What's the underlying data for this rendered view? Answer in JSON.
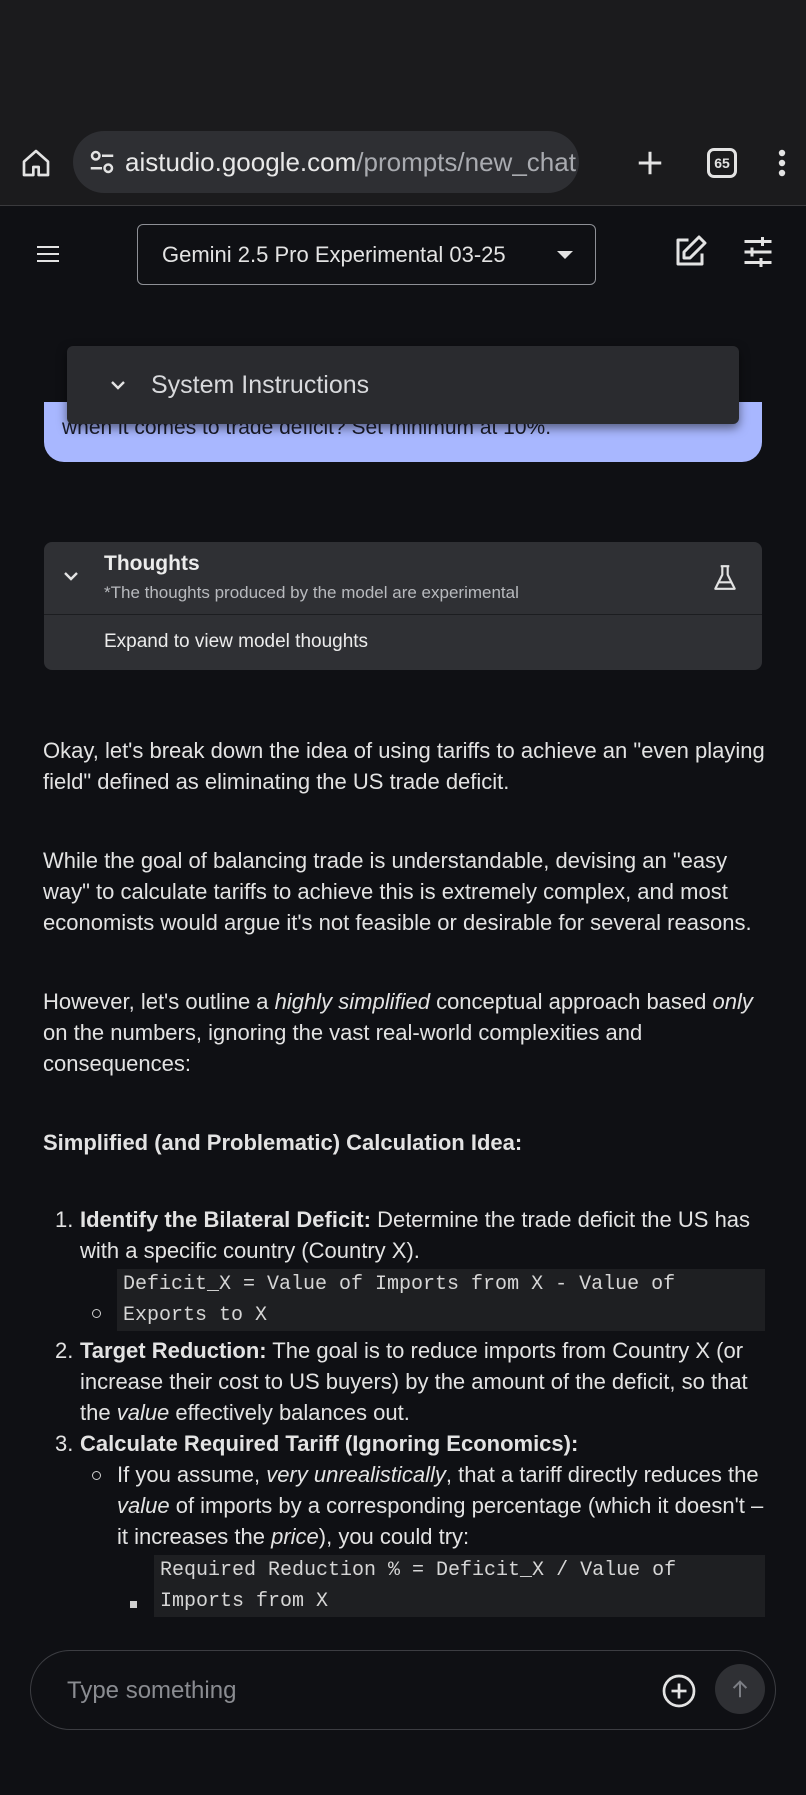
{
  "browser": {
    "url_host": "aistudio.google.com",
    "url_path": "/prompts/new_chat",
    "tab_count": "65"
  },
  "header": {
    "model_label": "Gemini 2.5 Pro Experimental 03-25"
  },
  "system_instructions": {
    "label": "System Instructions"
  },
  "user_message": {
    "visible_text": "when it comes to trade deficit? Set minimum at 10%."
  },
  "thoughts": {
    "title": "Thoughts",
    "subtitle": "*The thoughts produced by the model are experimental",
    "expand_label": "Expand to view model thoughts"
  },
  "response": {
    "p1": "Okay, let's break down the idea of using tariffs to achieve an \"even playing field\" defined as eliminating the US trade deficit.",
    "p2": "While the goal of balancing trade is understandable, devising an \"easy way\" to calculate tariffs to achieve this is extremely complex, and most economists would argue it's not feasible or desirable for several reasons.",
    "p3_a": "However, let's outline a ",
    "p3_em1": "highly simplified",
    "p3_b": " conceptual approach based ",
    "p3_em2": "only",
    "p3_c": " on the numbers, ignoring the vast real-world complexities and consequences:",
    "heading": "Simplified (and Problematic) Calculation Idea:",
    "steps": [
      {
        "num": "1.",
        "bold": "Identify the Bilateral Deficit:",
        "text": " Determine the trade deficit the US has with a specific country (Country X).",
        "code": "Deficit_X = Value of Imports from X - Value of Exports to X"
      },
      {
        "num": "2.",
        "bold": "Target Reduction:",
        "text_a": " The goal is to reduce imports from Country X (or increase their cost to US buyers) by the amount of the deficit, so that the ",
        "em": "value",
        "text_b": " effectively balances out."
      },
      {
        "num": "3.",
        "bold": "Calculate Required Tariff (Ignoring Economics):",
        "sub_a": "If you assume, ",
        "sub_em1": "very unrealistically",
        "sub_b": ", that a tariff directly reduces the ",
        "sub_em2": "value",
        "sub_c": " of imports by a corresponding percentage (which it doesn't – it increases the ",
        "sub_em3": "price",
        "sub_d": "), you could try:",
        "code": "Required Reduction % = Deficit_X / Value of Imports from X"
      }
    ]
  },
  "composer": {
    "placeholder": "Type something"
  }
}
